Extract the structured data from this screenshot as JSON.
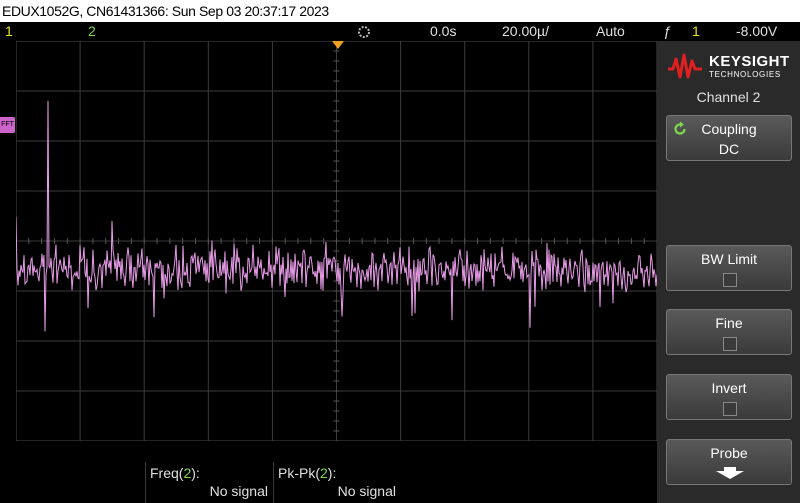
{
  "title_bar": "EDUX1052G, CN61431366: Sun Sep 03 20:37:17 2023",
  "status": {
    "ch1": "1",
    "ch2": "2",
    "delay": "0.0s",
    "timebase": "20.00µ/",
    "trigger_mode": "Auto",
    "trigger_icon": "ƒ",
    "trigger_source": "1",
    "trigger_level": "-8.00V"
  },
  "fft_marker": "FFT",
  "measurements": [
    {
      "label_prefix": "Freq(",
      "channel": "2",
      "label_suffix": "):",
      "value": "No signal"
    },
    {
      "label_prefix": "Pk-Pk(",
      "channel": "2",
      "label_suffix": "):",
      "value": "No signal"
    }
  ],
  "softkeys": {
    "brand": "KEYSIGHT",
    "brand_sub": "TECHNOLOGIES",
    "menu_title": "Channel 2",
    "coupling": {
      "label": "Coupling",
      "value": "DC"
    },
    "bw_limit": {
      "label": "BW Limit"
    },
    "fine": {
      "label": "Fine"
    },
    "invert": {
      "label": "Invert"
    },
    "probe": {
      "label": "Probe"
    }
  },
  "colors": {
    "trace": "#e79be7",
    "grid": "#3c3c3c",
    "trigger_marker": "#f0a020",
    "ch1": "#e8e800",
    "ch2": "#7fd84a"
  },
  "fft_trace": {
    "noise_floor_fraction": 0.43,
    "noise_amplitude_fraction": 0.08,
    "peaks": [
      {
        "div": 0.0,
        "level": 0.56
      },
      {
        "div": 0.5,
        "level": 0.85
      },
      {
        "div": 1.0,
        "level": 0.49
      },
      {
        "div": 1.5,
        "level": 0.55
      },
      {
        "div": 2.5,
        "level": 0.49
      }
    ]
  }
}
